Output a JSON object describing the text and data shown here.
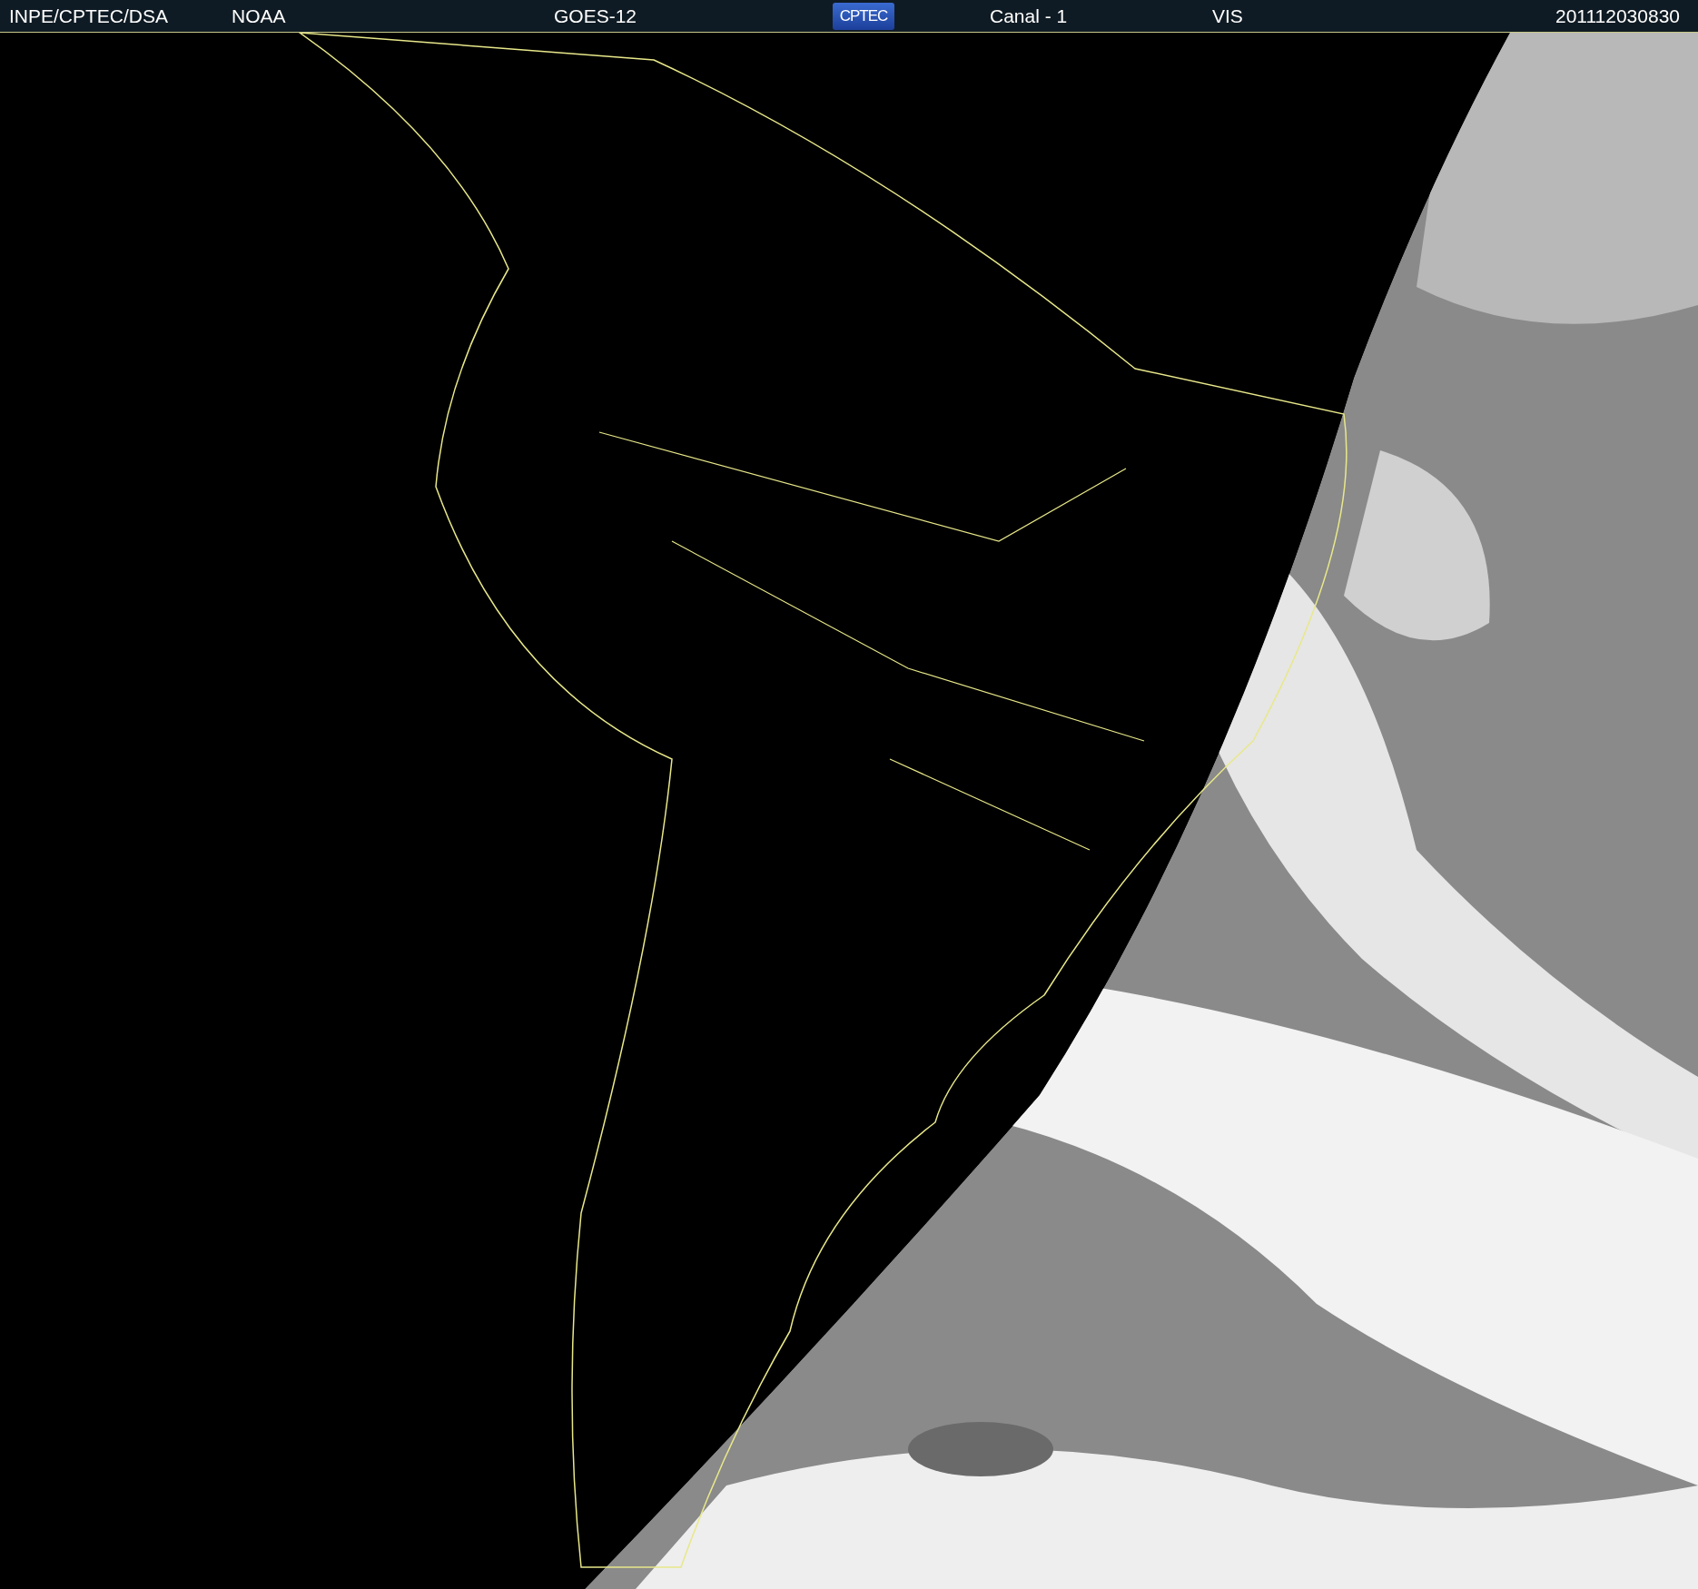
{
  "header": {
    "agency": "INPE/CPTEC/DSA",
    "source": "NOAA",
    "satellite": "GOES-12",
    "logo": "CPTEC",
    "channel": "Canal - 1",
    "band": "VIS",
    "timestamp": "201112030830"
  }
}
